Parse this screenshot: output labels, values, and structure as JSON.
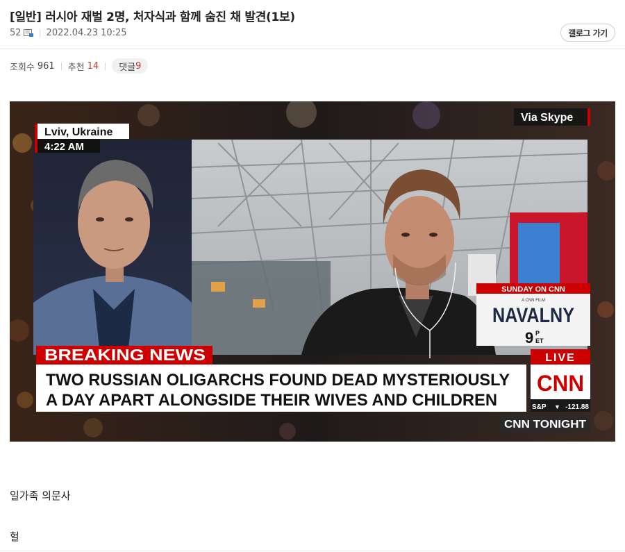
{
  "post": {
    "title": "[일반] 러시아 재벌 2명, 처자식과 함께 숨진 채 발견(1보)",
    "memo_count": "52",
    "datetime": "2022.04.23 10:25",
    "gallery_button": "갤로그 가기"
  },
  "stats": {
    "views_label": "조회수",
    "views": "961",
    "recommend_label": "추천",
    "recommend": "14",
    "comments_label": "댓글",
    "comments": "9"
  },
  "screenshot": {
    "location": "Lviv, Ukraine",
    "time": "4:22 AM",
    "via": "Via Skype",
    "breaking": "BREAKING NEWS",
    "headline_line1": "TWO RUSSIAN OLIGARCHS FOUND DEAD MYSTERIOUSLY",
    "headline_line2": "A DAY APART ALONGSIDE THEIR WIVES AND CHILDREN",
    "promo_top": "SUNDAY ON CNN",
    "promo_small": "A CNN FILM",
    "promo_title": "NAVALNY",
    "promo_time_num": "9",
    "promo_time_p": "P",
    "promo_time_et": "ET",
    "live": "LIVE",
    "network": "CNN",
    "ticker_label": "S&P",
    "ticker_arrow": "▼",
    "ticker_value": "-121.88",
    "show": "CNN TONIGHT",
    "colors": {
      "cnn_red": "#cc0000",
      "navy": "#1d2a45"
    }
  },
  "content": {
    "line1": "일가족 의문사",
    "line2": "헐"
  }
}
